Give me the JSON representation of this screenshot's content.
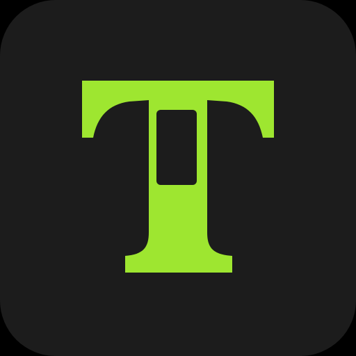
{
  "app_icon": {
    "glyph": "T",
    "colors": {
      "background": "#1c1c1c",
      "outer": "#000000",
      "glyph": "#9ee630",
      "slot": "#1c1c1c"
    }
  }
}
